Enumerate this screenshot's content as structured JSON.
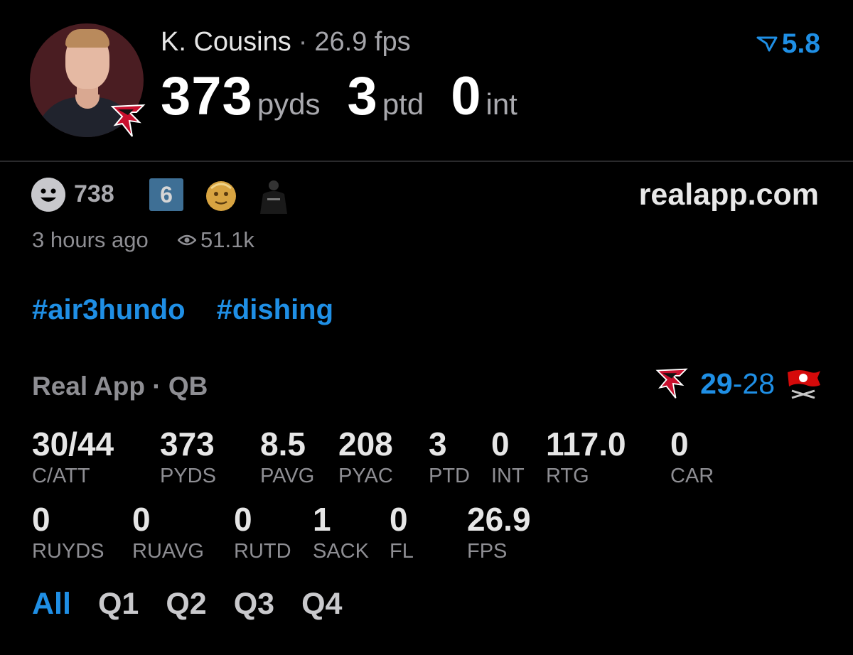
{
  "player": {
    "name": "K. Cousins",
    "fps_text": "26.9 fps",
    "projection": "5.8",
    "headline": [
      {
        "value": "373",
        "unit": "pyds"
      },
      {
        "value": "3",
        "unit": "ptd"
      },
      {
        "value": "0",
        "unit": "int"
      }
    ]
  },
  "social": {
    "likes": "738",
    "rank_badge": "6",
    "site": "realapp.com",
    "time_ago": "3 hours ago",
    "views": "51.1k"
  },
  "hashtags": [
    "#air3hundo",
    "#dishing"
  ],
  "section_title": "Real App · QB",
  "game": {
    "away_score": "29",
    "separator": "-",
    "home_score": "28"
  },
  "stats_row1": [
    {
      "value": "30/44",
      "label": "C/ATT"
    },
    {
      "value": "373",
      "label": "PYDS"
    },
    {
      "value": "8.5",
      "label": "PAVG"
    },
    {
      "value": "208",
      "label": "PYAC"
    },
    {
      "value": "3",
      "label": "PTD"
    },
    {
      "value": "0",
      "label": "INT"
    },
    {
      "value": "117.0",
      "label": "RTG"
    },
    {
      "value": "0",
      "label": "CAR"
    }
  ],
  "stats_row2": [
    {
      "value": "0",
      "label": "RUYDS"
    },
    {
      "value": "0",
      "label": "RUAVG"
    },
    {
      "value": "0",
      "label": "RUTD"
    },
    {
      "value": "1",
      "label": "SACK"
    },
    {
      "value": "0",
      "label": "FL"
    },
    {
      "value": "26.9",
      "label": "FPS"
    }
  ],
  "tabs": [
    {
      "label": "All",
      "active": true
    },
    {
      "label": "Q1",
      "active": false
    },
    {
      "label": "Q2",
      "active": false
    },
    {
      "label": "Q3",
      "active": false
    },
    {
      "label": "Q4",
      "active": false
    }
  ],
  "colors": {
    "accent": "#1f8fe5",
    "background": "#000000",
    "muted": "#8e8e93"
  },
  "icons": {
    "projection": "arrow-filter-icon",
    "likes": "smiley-icon",
    "views": "eye-icon",
    "team_away": "falcons-logo-icon",
    "team_home": "buccaneers-flag-icon"
  }
}
